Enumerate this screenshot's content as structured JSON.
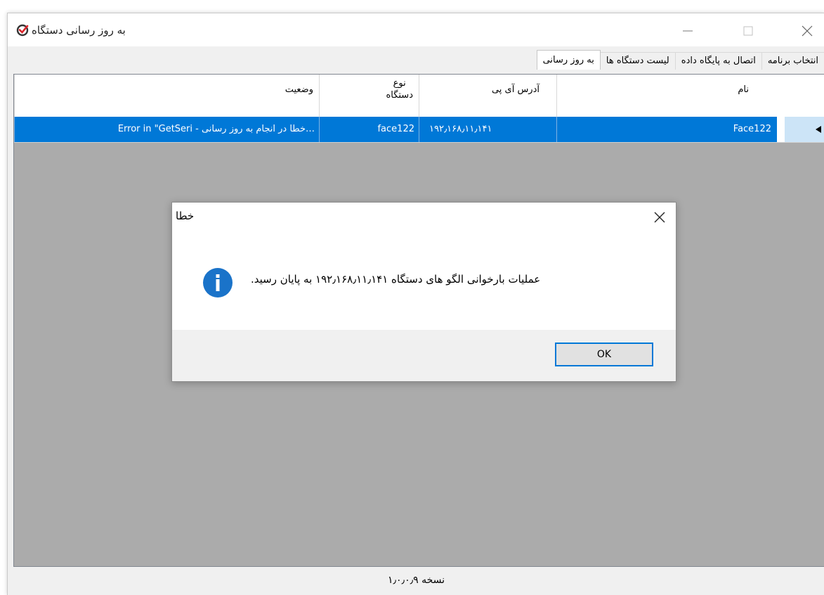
{
  "window": {
    "title": "به روز رسانی دستگاه",
    "accent_color": "#0078d7"
  },
  "tabs": [
    {
      "label": "انتخاب برنامه",
      "active": false
    },
    {
      "label": "اتصال به پایگاه داده",
      "active": false
    },
    {
      "label": "لیست دستگاه ها",
      "active": false
    },
    {
      "label": "به روز رسانی",
      "active": true
    }
  ],
  "grid": {
    "columns": {
      "name": "نام",
      "ip": "آدرس آی پی",
      "type_line1": "نوع",
      "type_line2": "دستگاه",
      "status": "وضعیت"
    },
    "rows": [
      {
        "name": "Face122",
        "ip": "۱۹۲٫۱۶۸٫۱۱٫۱۴۱",
        "type": "face122",
        "status": "…خطا در انجام به روز رسانی - Error in \"GetSeri"
      }
    ]
  },
  "status_bar": {
    "version": "نسخه ۱٫۰٫۰٫۹"
  },
  "dialog": {
    "title": "خطا",
    "message": "عملیات بارخوانی الگو های دستگاه ۱۹۲٫۱۶۸٫۱۱٫۱۴۱ به پایان رسید.",
    "ok_label": "OK",
    "icon": "info-icon"
  }
}
